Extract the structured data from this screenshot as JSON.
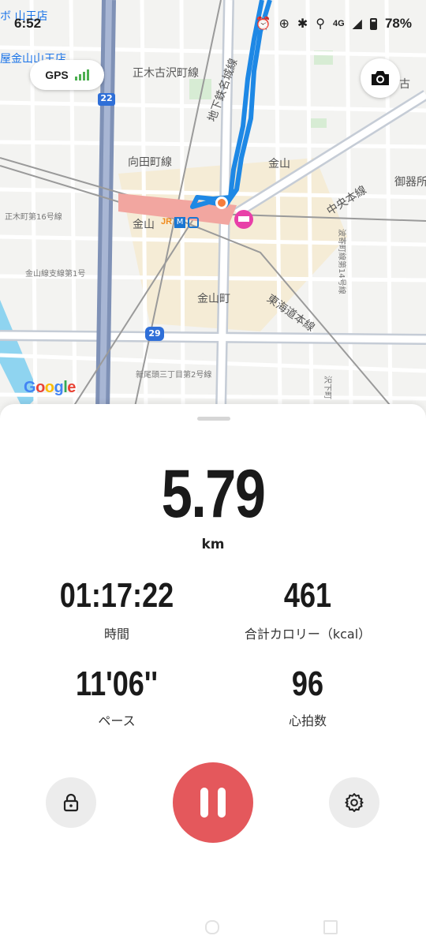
{
  "status_bar": {
    "time": "6:52",
    "network": "4G",
    "battery": "78%"
  },
  "map": {
    "labels": {
      "top_left_store": "ボ 山王店",
      "store2": "屋金山山王店",
      "route22": "22",
      "route29": "29",
      "shoki": "正木古沢町線",
      "subway": "地下鉄名城線",
      "mukaida": "向田町線",
      "kanayama": "金山",
      "chuo": "中央本線",
      "gokiso": "御器所",
      "masaki16": "正木町第16号線",
      "kanayama_station": "金山",
      "kanayamasen": "金山線支線第1号",
      "tokaido": "東海道本線",
      "kanayamacho": "金山町",
      "namiyose": "波寄町線第14号線",
      "shintakabashi": "新尾頭三丁目第2号線",
      "top_right": "古",
      "sawashita": "沢下町"
    },
    "gps_chip": "GPS",
    "google": "Google",
    "colors": {
      "route": "#1e88e5",
      "expressway": "#8a9cc2",
      "road": "#ffffff",
      "rail": "#9e9e9e",
      "station": "#f4a7a0"
    }
  },
  "stats": {
    "distance": "5.79",
    "distance_unit": "km",
    "time_value": "01:17:22",
    "time_label": "時間",
    "calories_value": "461",
    "calories_label": "合計カロリー（kcal）",
    "pace_value": "11'06''",
    "pace_label": "ペース",
    "heart_value": "96",
    "heart_label": "心拍数"
  },
  "controls": {
    "lock": "lock-icon",
    "pause": "pause-icon",
    "settings": "gear-icon",
    "pause_color": "#e4585c"
  }
}
